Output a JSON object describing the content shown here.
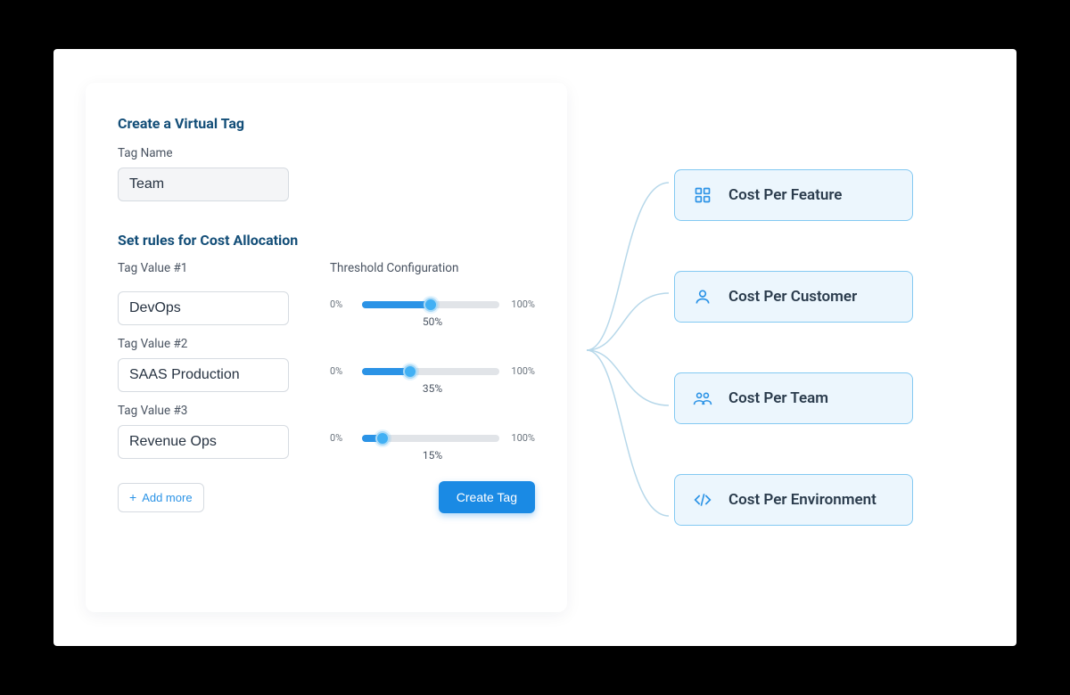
{
  "form": {
    "title": "Create a Virtual Tag",
    "tag_name_label": "Tag Name",
    "tag_name_value": "Team",
    "rules_title": "Set rules for Cost Allocation",
    "threshold_header": "Threshold Configuration",
    "slider_min_label": "0%",
    "slider_max_label": "100%",
    "rules": [
      {
        "label": "Tag Value #1",
        "value": "DevOps",
        "percent": 50,
        "percent_label": "50%"
      },
      {
        "label": "Tag Value #2",
        "value": "SAAS Production",
        "percent": 35,
        "percent_label": "35%"
      },
      {
        "label": "Tag Value #3",
        "value": "Revenue Ops",
        "percent": 15,
        "percent_label": "15%"
      }
    ],
    "add_more_label": "Add more",
    "create_button_label": "Create Tag"
  },
  "chips": [
    {
      "label": "Cost Per Feature",
      "icon": "grid-icon"
    },
    {
      "label": "Cost Per Customer",
      "icon": "user-icon"
    },
    {
      "label": "Cost Per Team",
      "icon": "team-icon"
    },
    {
      "label": "Cost Per Environment",
      "icon": "code-icon"
    }
  ]
}
